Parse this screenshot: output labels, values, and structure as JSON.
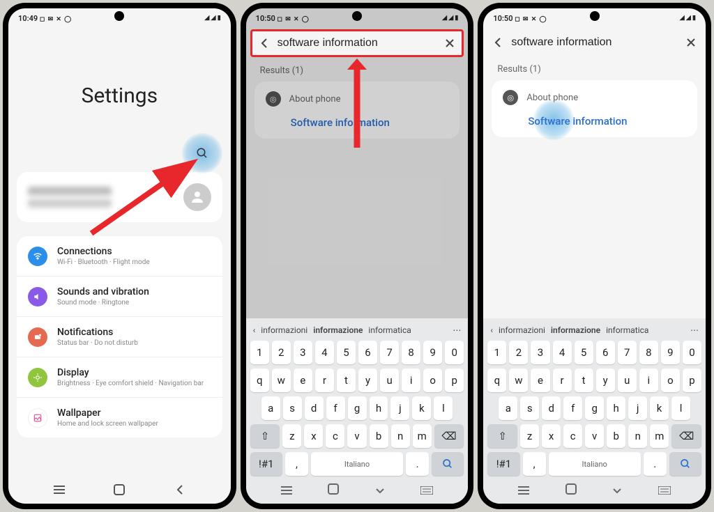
{
  "screen1": {
    "status": {
      "time": "10:49",
      "left_icons": "◻ ✉ ✕ ◯",
      "right_icons": "◢ ◢ ▮"
    },
    "title": "Settings",
    "items": [
      {
        "title": "Connections",
        "sub": "Wi-Fi · Bluetooth · Flight mode",
        "color": "#2a8eea",
        "glyph": "wifi"
      },
      {
        "title": "Sounds and vibration",
        "sub": "Sound mode · Ringtone",
        "color": "#8a5ae6",
        "glyph": "sound"
      },
      {
        "title": "Notifications",
        "sub": "Status bar · Do not disturb",
        "color": "#e66a4f",
        "glyph": "notif"
      },
      {
        "title": "Display",
        "sub": "Brightness · Eye comfort shield · Navigation bar",
        "color": "#8fc63d",
        "glyph": "display"
      },
      {
        "title": "Wallpaper",
        "sub": "Home and lock screen wallpaper",
        "color": "#e84f9a",
        "glyph": "wallpaper"
      }
    ]
  },
  "screen2": {
    "status": {
      "time": "10:50",
      "left_icons": "◻ ✉ ✕ ◯",
      "right_icons": "◢ ◢ ▮"
    },
    "search": {
      "value": "software information"
    },
    "results_label": "Results (1)",
    "result": {
      "app": "About phone",
      "link": "Software information"
    }
  },
  "screen3": {
    "status": {
      "time": "10:50",
      "left_icons": "◻ ✉ ✕ ◯",
      "right_icons": "◢ ◢ ▮"
    },
    "search": {
      "value": "software information"
    },
    "results_label": "Results (1)",
    "result": {
      "app": "About phone",
      "link": "Software information"
    }
  },
  "keyboard": {
    "suggestions": [
      "informazioni",
      "informazione",
      "informatica"
    ],
    "row1": [
      "1",
      "2",
      "3",
      "4",
      "5",
      "6",
      "7",
      "8",
      "9",
      "0"
    ],
    "row2": [
      "q",
      "w",
      "e",
      "r",
      "t",
      "y",
      "u",
      "i",
      "o",
      "p"
    ],
    "row3": [
      "a",
      "s",
      "d",
      "f",
      "g",
      "h",
      "j",
      "k",
      "l"
    ],
    "row4": [
      "z",
      "x",
      "c",
      "v",
      "b",
      "n",
      "m"
    ],
    "space_label": "Italiano",
    "symbol_key": "!#1",
    "comma": ",",
    "period": "."
  }
}
